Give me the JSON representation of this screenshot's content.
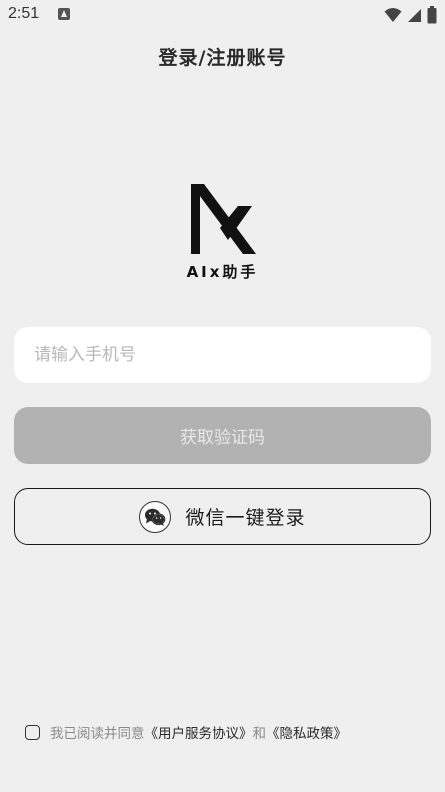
{
  "status_bar": {
    "time": "2:51"
  },
  "header": {
    "title": "登录/注册账号"
  },
  "logo": {
    "name": "AIx助手"
  },
  "phone_input": {
    "placeholder": "请输入手机号",
    "value": ""
  },
  "buttons": {
    "get_code": "获取验证码",
    "wechat_login": "微信一键登录"
  },
  "agreement": {
    "prefix": "我已阅读并同意",
    "user_agreement": "《用户服务协议》",
    "conjunction": "和",
    "privacy_policy": "《隐私政策》",
    "checked": false
  },
  "colors": {
    "background": "#efefef",
    "input_bg": "#ffffff",
    "disabled_button": "#b2b2b2",
    "text_dark": "#1a1a1a",
    "text_muted": "#8a8a8a"
  },
  "icons": {
    "wifi": "wifi-icon",
    "signal": "signal-icon",
    "battery": "battery-icon",
    "wechat": "wechat-icon",
    "app_notification": "notification-icon"
  }
}
